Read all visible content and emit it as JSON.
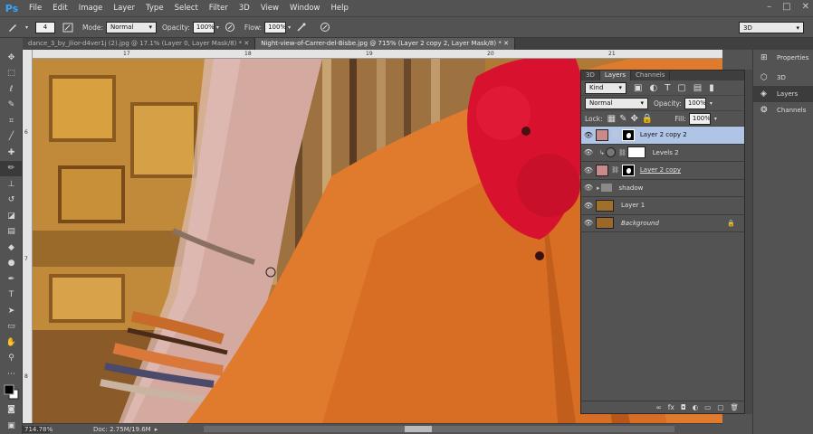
{
  "menubar": {
    "logo": "Ps",
    "items": [
      "File",
      "Edit",
      "Image",
      "Layer",
      "Type",
      "Select",
      "Filter",
      "3D",
      "View",
      "Window",
      "Help"
    ],
    "window_controls": [
      "–",
      "□",
      "✕"
    ]
  },
  "options": {
    "brush_size": "4",
    "mode_label": "Mode:",
    "mode_value": "Normal",
    "opacity_label": "Opacity:",
    "opacity_value": "100%",
    "flow_label": "Flow:",
    "flow_value": "100%",
    "workspace": "3D"
  },
  "tabs": [
    {
      "label": "dance_3_by_jlior-d4ver1j (2).jpg @ 17.1% (Layer 0, Layer Mask/8) *",
      "active": false
    },
    {
      "label": "Night-view-of-Carrer-del-Bisbe.jpg @ 715% (Layer 2 copy 2, Layer Mask/8) *",
      "active": true
    }
  ],
  "ruler": {
    "top": [
      "17",
      "18",
      "19",
      "20",
      "21"
    ],
    "left": [
      "6",
      "7",
      "8"
    ]
  },
  "status": {
    "zoom": "714.78%",
    "doc": "Doc: 2.75M/19.6M"
  },
  "layers_panel": {
    "tabs": [
      "3D",
      "Layers",
      "Channels"
    ],
    "kind_label": "Kind",
    "blend_mode": "Normal",
    "opacity_label": "Opacity:",
    "opacity_value": "100%",
    "lock_label": "Lock:",
    "fill_label": "Fill:",
    "fill_value": "100%",
    "layers": [
      {
        "name": "Layer 2 copy 2",
        "selected": true
      },
      {
        "name": "Levels 2",
        "selected": false
      },
      {
        "name": "Layer 2 copy",
        "selected": false
      },
      {
        "name": "shadow",
        "selected": false
      },
      {
        "name": "Layer 1",
        "selected": false
      },
      {
        "name": "Background",
        "selected": false
      }
    ],
    "bottom_icons": [
      "∞",
      "fx",
      "◘",
      "◐",
      "▭",
      "▢",
      "🗑"
    ]
  },
  "right_dock": {
    "items": [
      "Properties",
      "3D",
      "Layers",
      "Channels"
    ]
  }
}
